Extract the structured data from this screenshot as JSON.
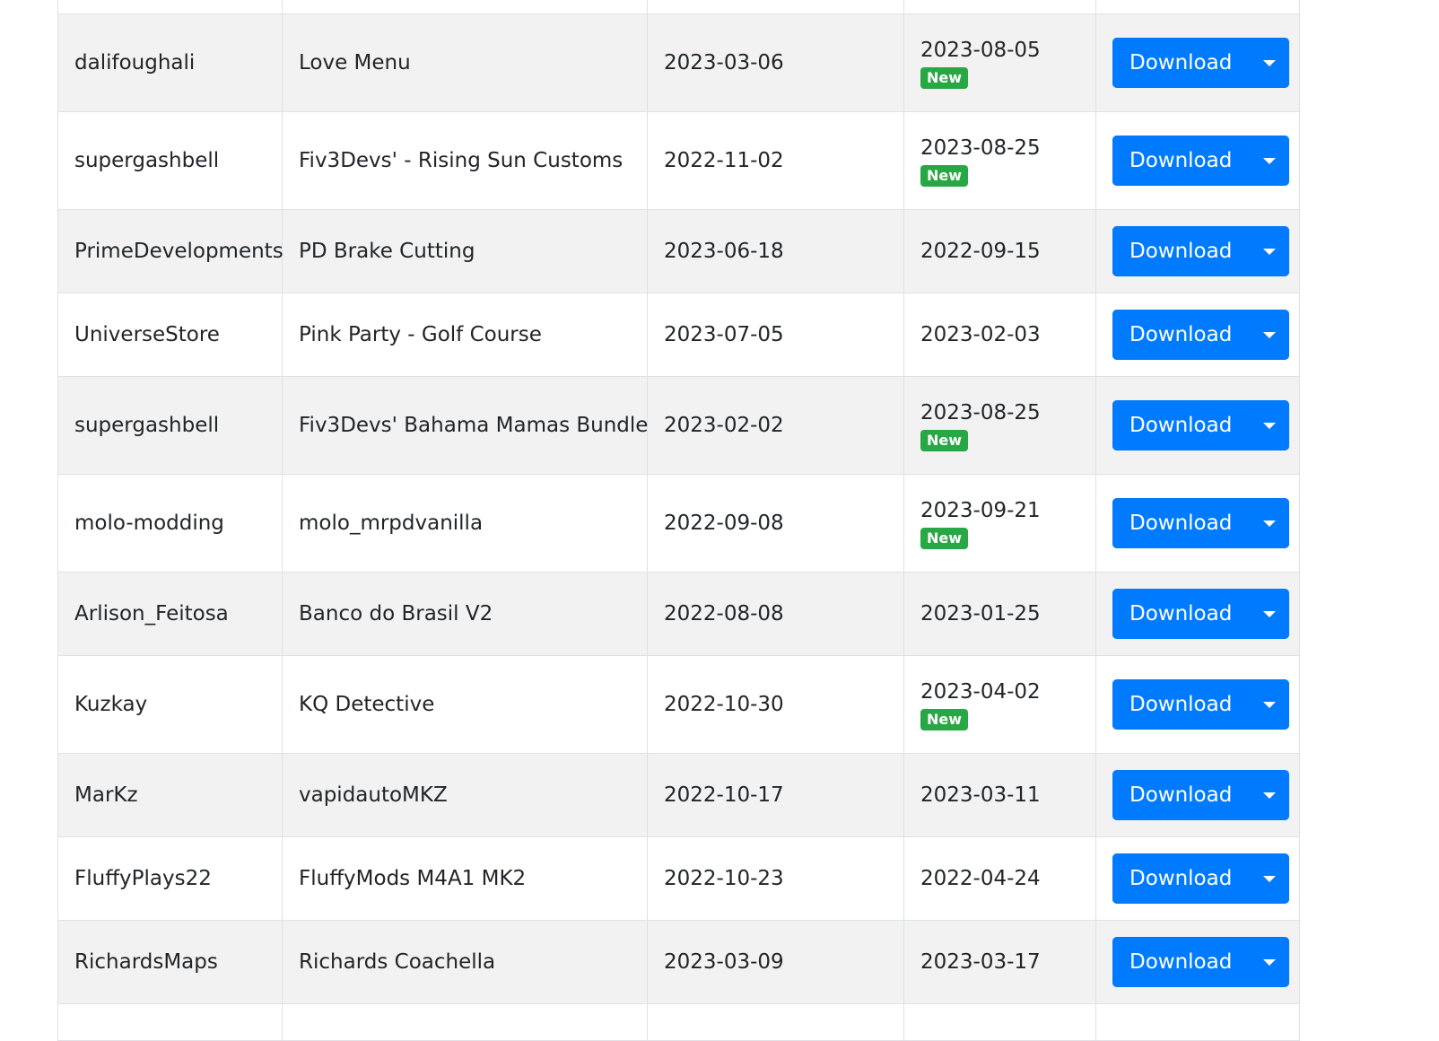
{
  "colors": {
    "primary": "#007bff",
    "success": "#28a745",
    "stripe": "#f2f2f2",
    "border": "#dee2e6"
  },
  "button_label": "Download",
  "badge_label": "New",
  "rows": [
    {
      "author": "dalifoughali",
      "name": "Love Menu",
      "created": "2023-03-06",
      "updated": "2023-08-05",
      "is_new": true
    },
    {
      "author": "supergashbell",
      "name": "Fiv3Devs' - Rising Sun Customs",
      "created": "2022-11-02",
      "updated": "2023-08-25",
      "is_new": true
    },
    {
      "author": "PrimeDevelopments",
      "name": "PD Brake Cutting",
      "created": "2023-06-18",
      "updated": "2022-09-15",
      "is_new": false
    },
    {
      "author": "UniverseStore",
      "name": "Pink Party - Golf Course",
      "created": "2023-07-05",
      "updated": "2023-02-03",
      "is_new": false
    },
    {
      "author": "supergashbell",
      "name": "Fiv3Devs' Bahama Mamas Bundle",
      "created": "2023-02-02",
      "updated": "2023-08-25",
      "is_new": true
    },
    {
      "author": "molo-modding",
      "name": "molo_mrpdvanilla",
      "created": "2022-09-08",
      "updated": "2023-09-21",
      "is_new": true
    },
    {
      "author": "Arlison_Feitosa",
      "name": "Banco do Brasil V2",
      "created": "2022-08-08",
      "updated": "2023-01-25",
      "is_new": false
    },
    {
      "author": "Kuzkay",
      "name": "KQ Detective",
      "created": "2022-10-30",
      "updated": "2023-04-02",
      "is_new": true
    },
    {
      "author": "MarKz",
      "name": "vapidautoMKZ",
      "created": "2022-10-17",
      "updated": "2023-03-11",
      "is_new": false
    },
    {
      "author": "FluffyPlays22",
      "name": "FluffyMods M4A1 MK2",
      "created": "2022-10-23",
      "updated": "2022-04-24",
      "is_new": false
    },
    {
      "author": "RichardsMaps",
      "name": "Richards Coachella",
      "created": "2023-03-09",
      "updated": "2023-03-17",
      "is_new": false
    }
  ]
}
